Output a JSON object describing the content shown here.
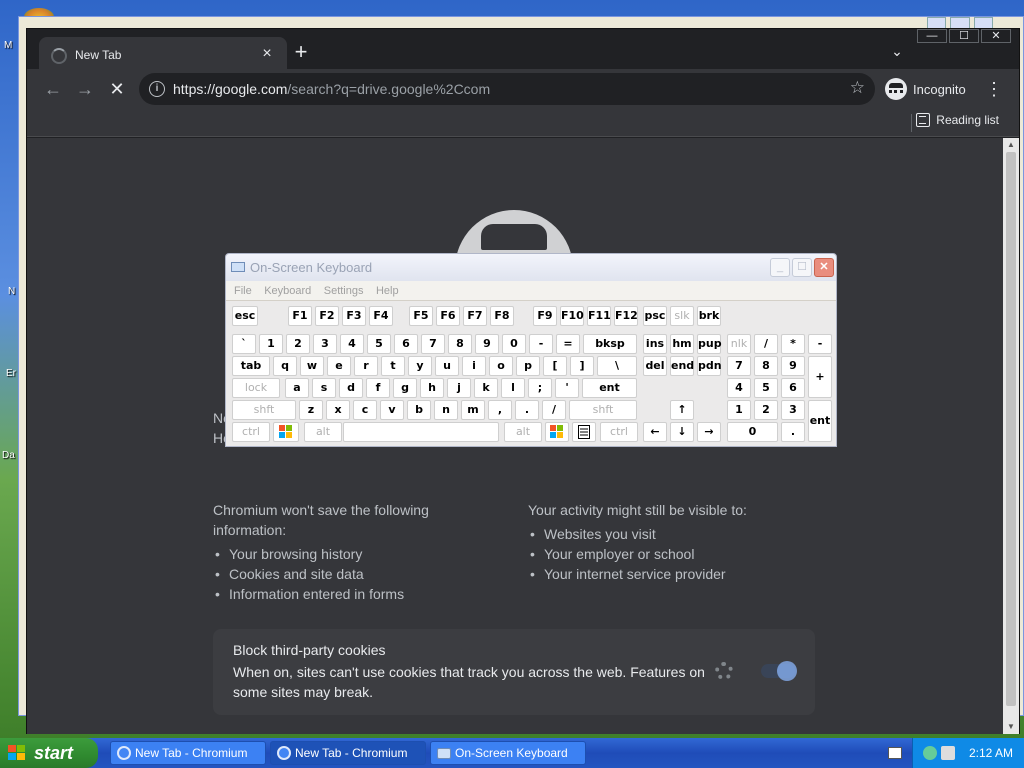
{
  "desktop": {
    "labels": [
      "M",
      "N",
      "Er",
      "Da"
    ]
  },
  "browser": {
    "tab_title": "New Tab",
    "tab_close": "×",
    "new_tab": "+",
    "tab_search": "⌄",
    "window_controls": [
      "—",
      "☐",
      "✕"
    ],
    "url_host": "https://google.com",
    "url_rest": "/search?q=drive.google%2Ccom",
    "incognito_label": "Incognito",
    "reading_list": "Reading list"
  },
  "page": {
    "lead_1": "No",
    "lead_2": "Ho",
    "left_heading": "Chromium won't save the following information:",
    "left_items": [
      "Your browsing history",
      "Cookies and site data",
      "Information entered in forms"
    ],
    "right_heading": "Your activity might still be visible to:",
    "right_items": [
      "Websites you visit",
      "Your employer or school",
      "Your internet service provider"
    ],
    "cookie_title": "Block third-party cookies",
    "cookie_desc": "When on, sites can't use cookies that track you across the web. Features on some sites may break.",
    "cookie_toggle_on": true
  },
  "osk": {
    "title": "On-Screen Keyboard",
    "menu": [
      "File",
      "Keyboard",
      "Settings",
      "Help"
    ],
    "rows": [
      [
        "esc",
        "F1",
        "F2",
        "F3",
        "F4",
        "F5",
        "F6",
        "F7",
        "F8",
        "F9",
        "F10",
        "F11",
        "F12",
        "psc",
        "slk",
        "brk"
      ],
      [
        "`",
        "1",
        "2",
        "3",
        "4",
        "5",
        "6",
        "7",
        "8",
        "9",
        "0",
        "-",
        "=",
        "bksp",
        "ins",
        "hm",
        "pup",
        "nlk",
        "/",
        "*",
        "-"
      ],
      [
        "tab",
        "q",
        "w",
        "e",
        "r",
        "t",
        "y",
        "u",
        "i",
        "o",
        "p",
        "[",
        "]",
        "\\",
        "del",
        "end",
        "pdn",
        "7",
        "8",
        "9",
        "+"
      ],
      [
        "lock",
        "a",
        "s",
        "d",
        "f",
        "g",
        "h",
        "j",
        "k",
        "l",
        ";",
        "'",
        "ent",
        "4",
        "5",
        "6"
      ],
      [
        "shft",
        "z",
        "x",
        "c",
        "v",
        "b",
        "n",
        "m",
        ",",
        ".",
        "/",
        "shft",
        "↑",
        "1",
        "2",
        "3",
        "ent"
      ],
      [
        "ctrl",
        "alt",
        "alt",
        "ctrl",
        "←",
        "↓",
        "→",
        "0",
        "."
      ]
    ]
  },
  "taskbar": {
    "start_label": "start",
    "tasks": [
      "New Tab - Chromium",
      "New Tab - Chromium",
      "On-Screen Keyboard"
    ],
    "clock": "2:12 AM"
  }
}
